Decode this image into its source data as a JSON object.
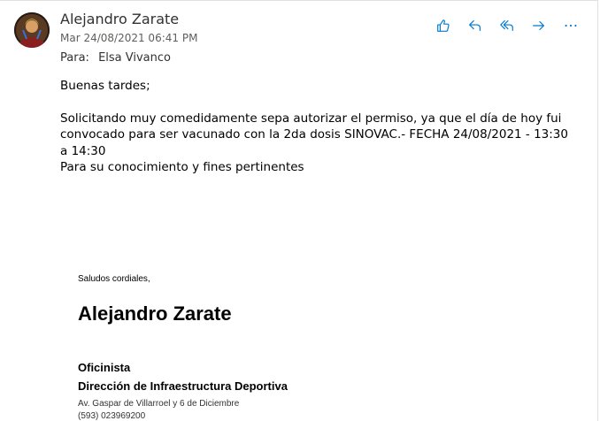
{
  "message": {
    "sender_name": "Alejandro Zarate",
    "sent_date": "Mar 24/08/2021 06:41 PM",
    "to_label": "Para:",
    "to_name": "Elsa Vivanco"
  },
  "actions": {
    "icons": [
      "like-icon",
      "reply-icon",
      "reply-all-icon",
      "forward-icon",
      "more-options-icon"
    ],
    "accent_color": "#0078d4"
  },
  "body": {
    "greeting": "Buenas tardes;",
    "paragraph_1": "Solicitando muy comedidamente sepa autorizar el permiso, ya que el día de hoy fui convocado para ser vacunado con la 2da dosis SINOVAC.- FECHA 24/08/2021 - 13:30 a 14:30",
    "paragraph_2": "Para su conocimiento y fines pertinentes"
  },
  "signature": {
    "greeting": "Saludos cordiales,",
    "name": "Alejandro Zarate",
    "title": "Oficinista",
    "department": "Dirección de Infraestructura Deportiva",
    "address": "Av. Gaspar de Villarroel y 6 de Diciembre",
    "phone": "(593) 023969200"
  }
}
